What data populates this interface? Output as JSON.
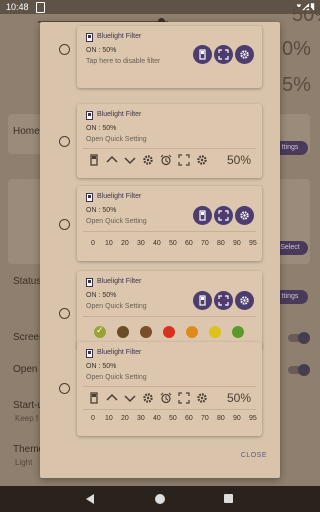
{
  "status_bar": {
    "time": "10:48"
  },
  "background": {
    "percentages": [
      "50%",
      "0%",
      "5%"
    ],
    "labels": {
      "home": "Home",
      "status": "Status",
      "screen": "Screen",
      "open": "Open v",
      "startup": "Start-u",
      "startup_sub": "Keep f",
      "theme": "Theme",
      "theme_sub": "Light"
    },
    "pills": [
      "ttings",
      "Select",
      "ttings"
    ]
  },
  "dialog": {
    "options": [
      {
        "title": "Bluelight Filter",
        "on": "ON : 50%",
        "sub": "Tap here to disable filter"
      },
      {
        "title": "Bluelight Filter",
        "on": "ON : 50%",
        "sub": "Open Quick Setting",
        "percent": "50%"
      },
      {
        "title": "Bluelight Filter",
        "on": "ON : 50%",
        "sub": "Open Quick Setting",
        "numbers": [
          "0",
          "10",
          "20",
          "30",
          "40",
          "50",
          "60",
          "70",
          "80",
          "90",
          "95"
        ]
      },
      {
        "title": "Bluelight Filter",
        "on": "ON : 50%",
        "sub": "Open Quick Setting",
        "colors": [
          "#9aa234",
          "#6b4a26",
          "#7a4e2a",
          "#d8321e",
          "#e08a1a",
          "#dcc21c",
          "#5a9a2a"
        ]
      },
      {
        "title": "Bluelight Filter",
        "on": "ON : 50%",
        "sub": "Open Quick Setting",
        "percent": "50%",
        "numbers": [
          "0",
          "10",
          "20",
          "30",
          "40",
          "50",
          "60",
          "70",
          "80",
          "90",
          "95"
        ]
      }
    ],
    "close_label": "CLOSE"
  },
  "icons": {
    "phone": "phone-icon",
    "fullscreen": "fullscreen-icon",
    "settings": "gear-icon",
    "up": "chevron-up-icon",
    "down": "chevron-down-icon",
    "alarm": "alarm-icon"
  },
  "colors": {
    "button_purple": "#4d3c6e",
    "dialog_bg": "#d9c4ab"
  }
}
